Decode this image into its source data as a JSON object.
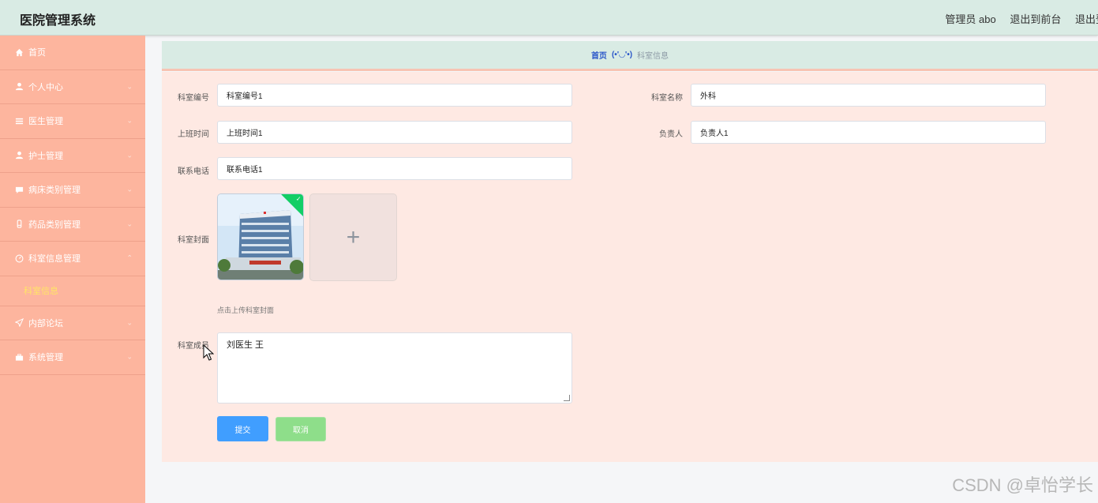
{
  "header": {
    "title": "医院管理系统",
    "admin_label": "管理员 abo",
    "exit_front": "退出到前台",
    "logout": "退出登"
  },
  "sidebar": {
    "items": [
      {
        "label": "首页",
        "icon": "home-icon"
      },
      {
        "label": "个人中心",
        "icon": "user-icon"
      },
      {
        "label": "医生管理",
        "icon": "list-icon"
      },
      {
        "label": "护士管理",
        "icon": "user-icon"
      },
      {
        "label": "病床类别管理",
        "icon": "chat-icon"
      },
      {
        "label": "药品类别管理",
        "icon": "bottle-icon"
      },
      {
        "label": "科室信息管理",
        "icon": "clock-icon"
      },
      {
        "label": "内部论坛",
        "icon": "send-icon"
      },
      {
        "label": "系统管理",
        "icon": "briefcase-icon"
      }
    ],
    "submenu_active": "科室信息",
    "submenu_color": "#ffe566"
  },
  "breadcrumb": {
    "home": "首页",
    "face": "(•'◡'•)",
    "current": "科室信息"
  },
  "form": {
    "dept_no_label": "科室编号",
    "dept_no_value": "科室编号1",
    "dept_name_label": "科室名称",
    "dept_name_value": "外科",
    "work_time_label": "上班时间",
    "work_time_value": "上班时间1",
    "leader_label": "负责人",
    "leader_value": "负责人1",
    "phone_label": "联系电话",
    "phone_value": "联系电话1",
    "cover_label": "科室封面",
    "upload_hint": "点击上传科室封面",
    "members_label": "科室成员",
    "members_value": "刘医生  王",
    "submit_label": "提交",
    "cancel_label": "取消"
  },
  "colors": {
    "sidebar_bg": "#fdb59e",
    "header_bg": "#d9ebe4",
    "submit": "#409eff",
    "cancel": "#8ede8a"
  },
  "watermark": "CSDN @卓怡学长"
}
